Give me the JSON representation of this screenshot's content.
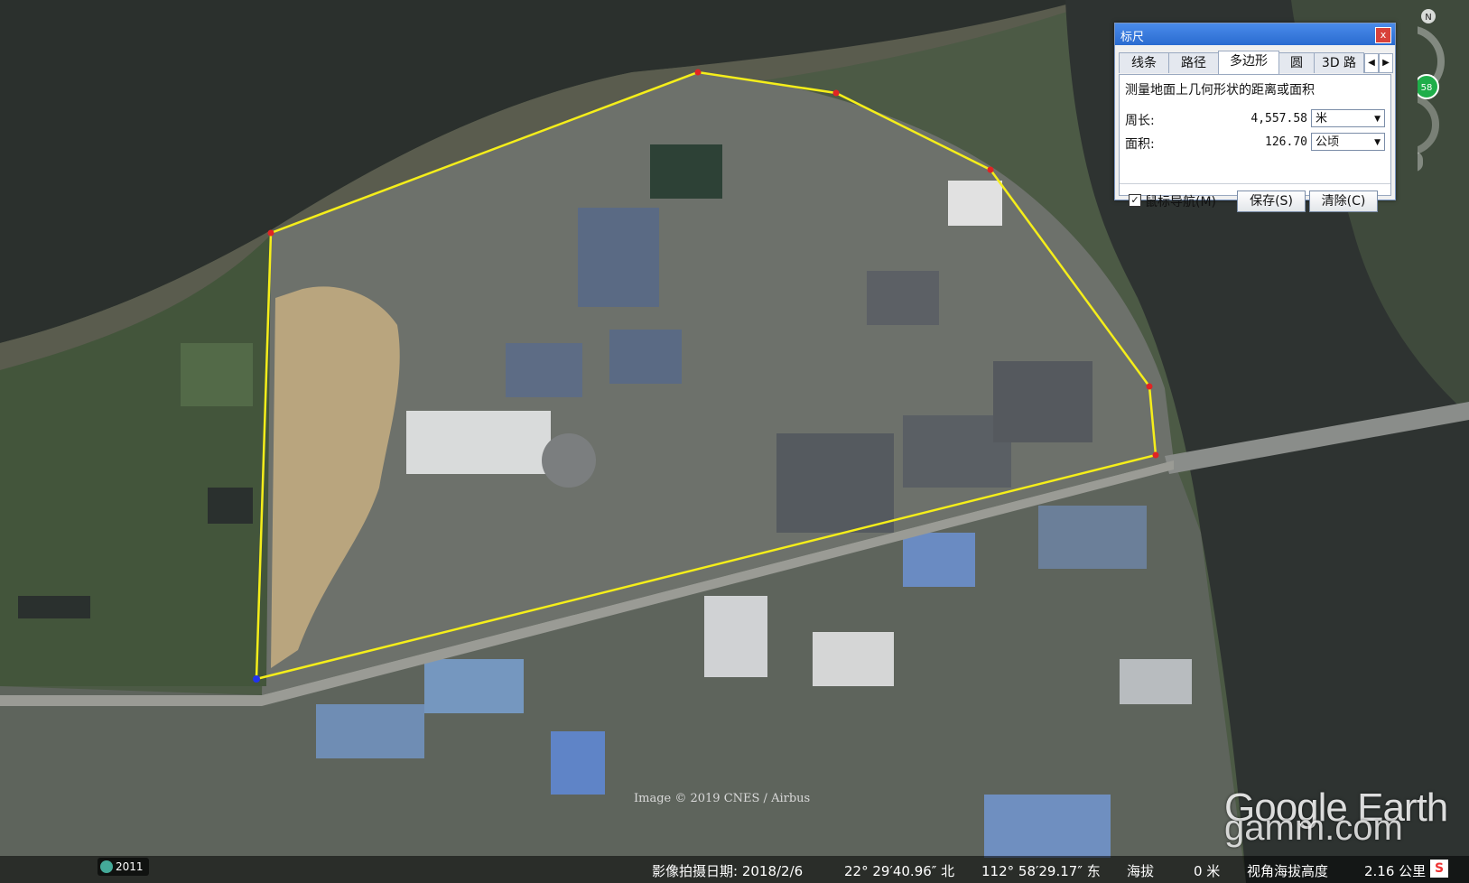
{
  "ruler": {
    "title": "标尺",
    "close_label": "x",
    "tabs": [
      "线条",
      "路径",
      "多边形",
      "圆",
      "3D 路"
    ],
    "active_tab": "多边形",
    "description": "测量地面上几何形状的距离或面积",
    "perimeter": {
      "label": "周长:",
      "value": "4,557.58",
      "unit": "米"
    },
    "area": {
      "label": "面积:",
      "value": "126.70",
      "unit": "公顷"
    },
    "mouse_nav": {
      "label": "鼠标导航(M)",
      "checked": true
    },
    "save_label": "保存(S)",
    "clear_label": "清除(C)"
  },
  "map": {
    "copyright": "Image © 2019 CNES / Airbus",
    "brand": "Google Earth",
    "watermark": "gamm.com",
    "year_badge": "2011",
    "north_label": "N",
    "zoom_badge": "58",
    "river_color": "#2f3532",
    "polygon_color": "#f5ee1a"
  },
  "status": {
    "capture_date": "影像拍摄日期: 2018/2/6",
    "latitude": "22° 29′40.96″ 北",
    "longitude": "112° 58′29.17″ 东",
    "elev_label": "海拔",
    "elev_value": "0 米",
    "eye_label": "视角海拔高度",
    "eye_value": "2.16 公里"
  },
  "ime_label": "S"
}
